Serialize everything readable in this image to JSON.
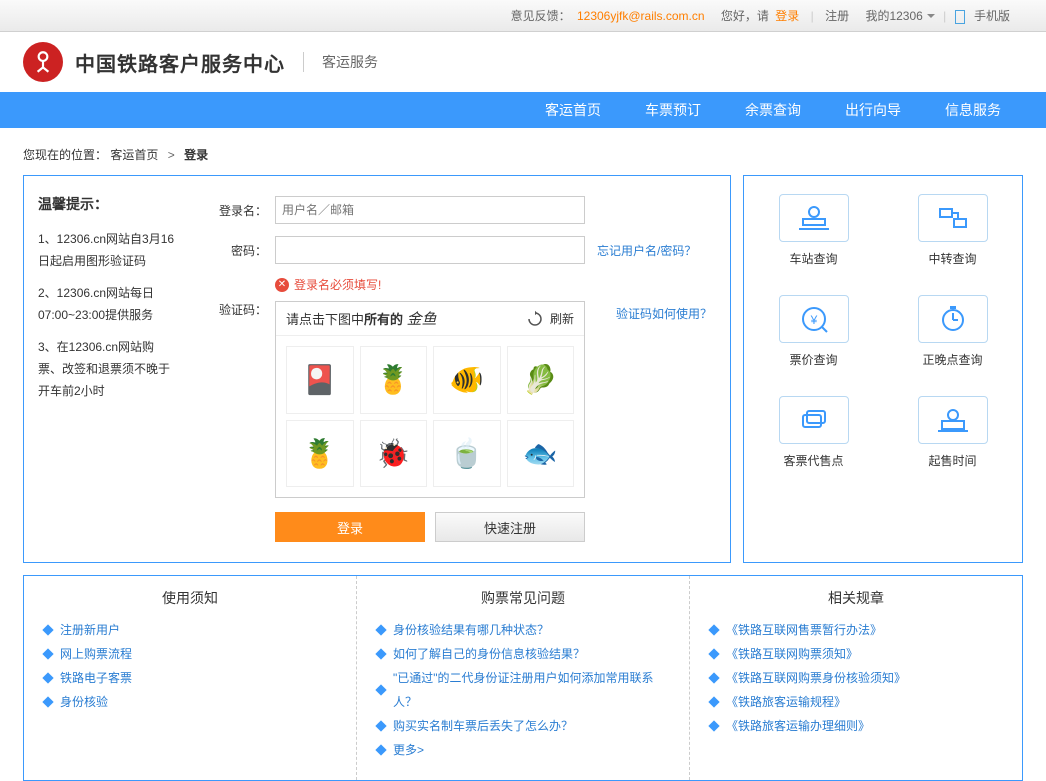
{
  "topbar": {
    "feedback_label": "意见反馈：",
    "feedback_email": "12306yjfk@rails.com.cn",
    "greeting": "您好，请",
    "login": "登录",
    "register": "注册",
    "my12306": "我的12306",
    "mobile": "手机版"
  },
  "header": {
    "title": "中国铁路客户服务中心",
    "subtitle": "客运服务"
  },
  "nav": [
    "客运首页",
    "车票预订",
    "余票查询",
    "出行向导",
    "信息服务"
  ],
  "breadcrumb": {
    "prefix": "您现在的位置：",
    "home": "客运首页",
    "sep": ">",
    "current": "登录"
  },
  "tips": {
    "heading": "温馨提示：",
    "items": [
      "1、12306.cn网站自3月16日起启用图形验证码",
      "2、12306.cn网站每日07:00~23:00提供服务",
      "3、在12306.cn网站购票、改签和退票须不晚于开车前2小时"
    ]
  },
  "form": {
    "username_label": "登录名：",
    "username_placeholder": "用户名／邮箱",
    "password_label": "密码：",
    "forgot_link": "忘记用户名/密码？",
    "error": "登录名必须填写!",
    "captcha_label": "验证码：",
    "captcha_help": "验证码如何使用？",
    "captcha_prompt_prefix": "请点击下图中",
    "captcha_prompt_bold": "所有的",
    "captcha_target": "金鱼",
    "refresh": "刷新",
    "login_btn": "登录",
    "register_btn": "快速注册"
  },
  "captcha_images": [
    "card",
    "pineapple",
    "goldfish",
    "cabbage",
    "pineapple2",
    "ladybug",
    "bowl",
    "goldfish2"
  ],
  "side": [
    {
      "label": "车站查询",
      "icon": "station"
    },
    {
      "label": "中转查询",
      "icon": "transfer"
    },
    {
      "label": "票价查询",
      "icon": "price"
    },
    {
      "label": "正晚点查询",
      "icon": "ontime"
    },
    {
      "label": "客票代售点",
      "icon": "outlet"
    },
    {
      "label": "起售时间",
      "icon": "saletime"
    }
  ],
  "bottom": [
    {
      "title": "使用须知",
      "items": [
        "注册新用户",
        "网上购票流程",
        "铁路电子客票",
        "身份核验"
      ]
    },
    {
      "title": "购票常见问题",
      "items": [
        "身份核验结果有哪几种状态？",
        "如何了解自己的身份信息核验结果？",
        "\"已通过\"的二代身份证注册用户如何添加常用联系人？",
        "购买实名制车票后丢失了怎么办？",
        "更多>"
      ]
    },
    {
      "title": "相关规章",
      "items": [
        "《铁路互联网售票暂行办法》",
        "《铁路互联网购票须知》",
        "《铁路互联网购票身份核验须知》",
        "《铁路旅客运输规程》",
        "《铁路旅客运输办理细则》"
      ]
    }
  ]
}
